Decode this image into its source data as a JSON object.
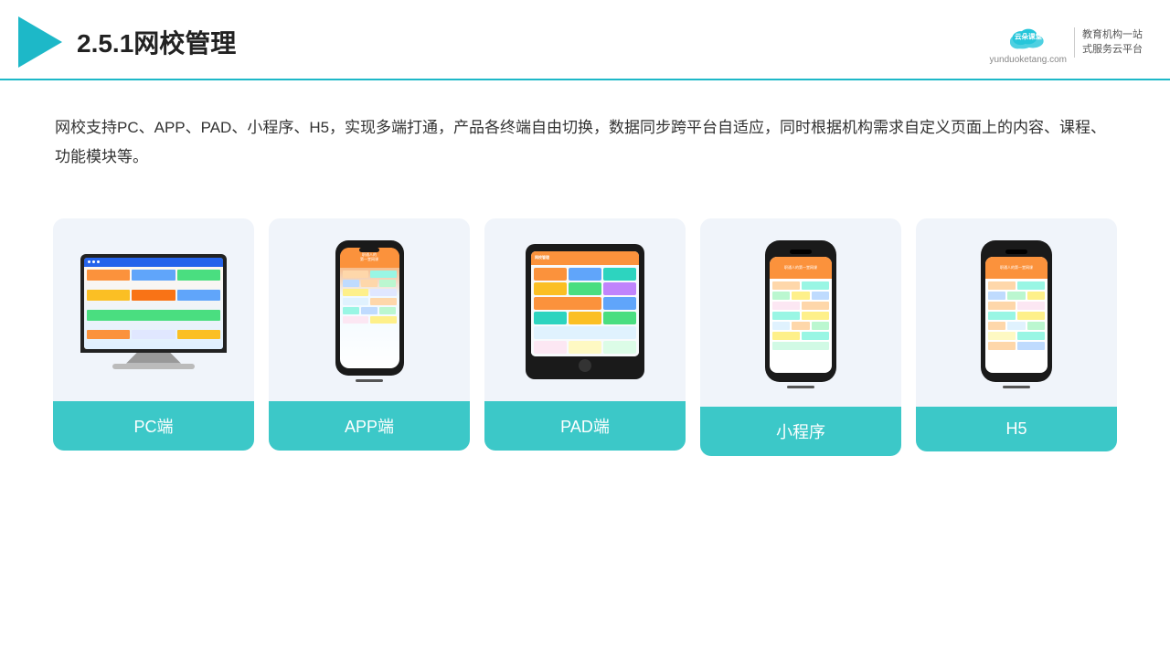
{
  "header": {
    "title": "2.5.1网校管理",
    "brand_name": "云朵课堂",
    "brand_domain": "yunduoketang.com",
    "brand_slogan": "教育机构一站\n式服务云平台"
  },
  "description": {
    "text": "网校支持PC、APP、PAD、小程序、H5，实现多端打通，产品各终端自由切换，数据同步跨平台自适应，同时根据机构需求自定义页面上的内容、课程、功能模块等。"
  },
  "cards": [
    {
      "id": "pc",
      "label": "PC端"
    },
    {
      "id": "app",
      "label": "APP端"
    },
    {
      "id": "pad",
      "label": "PAD端"
    },
    {
      "id": "miniprogram",
      "label": "小程序"
    },
    {
      "id": "h5",
      "label": "H5"
    }
  ],
  "colors": {
    "accent": "#3cc8c8",
    "header_border": "#1db8c8",
    "triangle": "#1db8c8",
    "card_bg": "#f0f4fa",
    "label_bg": "#3cc8c8"
  }
}
